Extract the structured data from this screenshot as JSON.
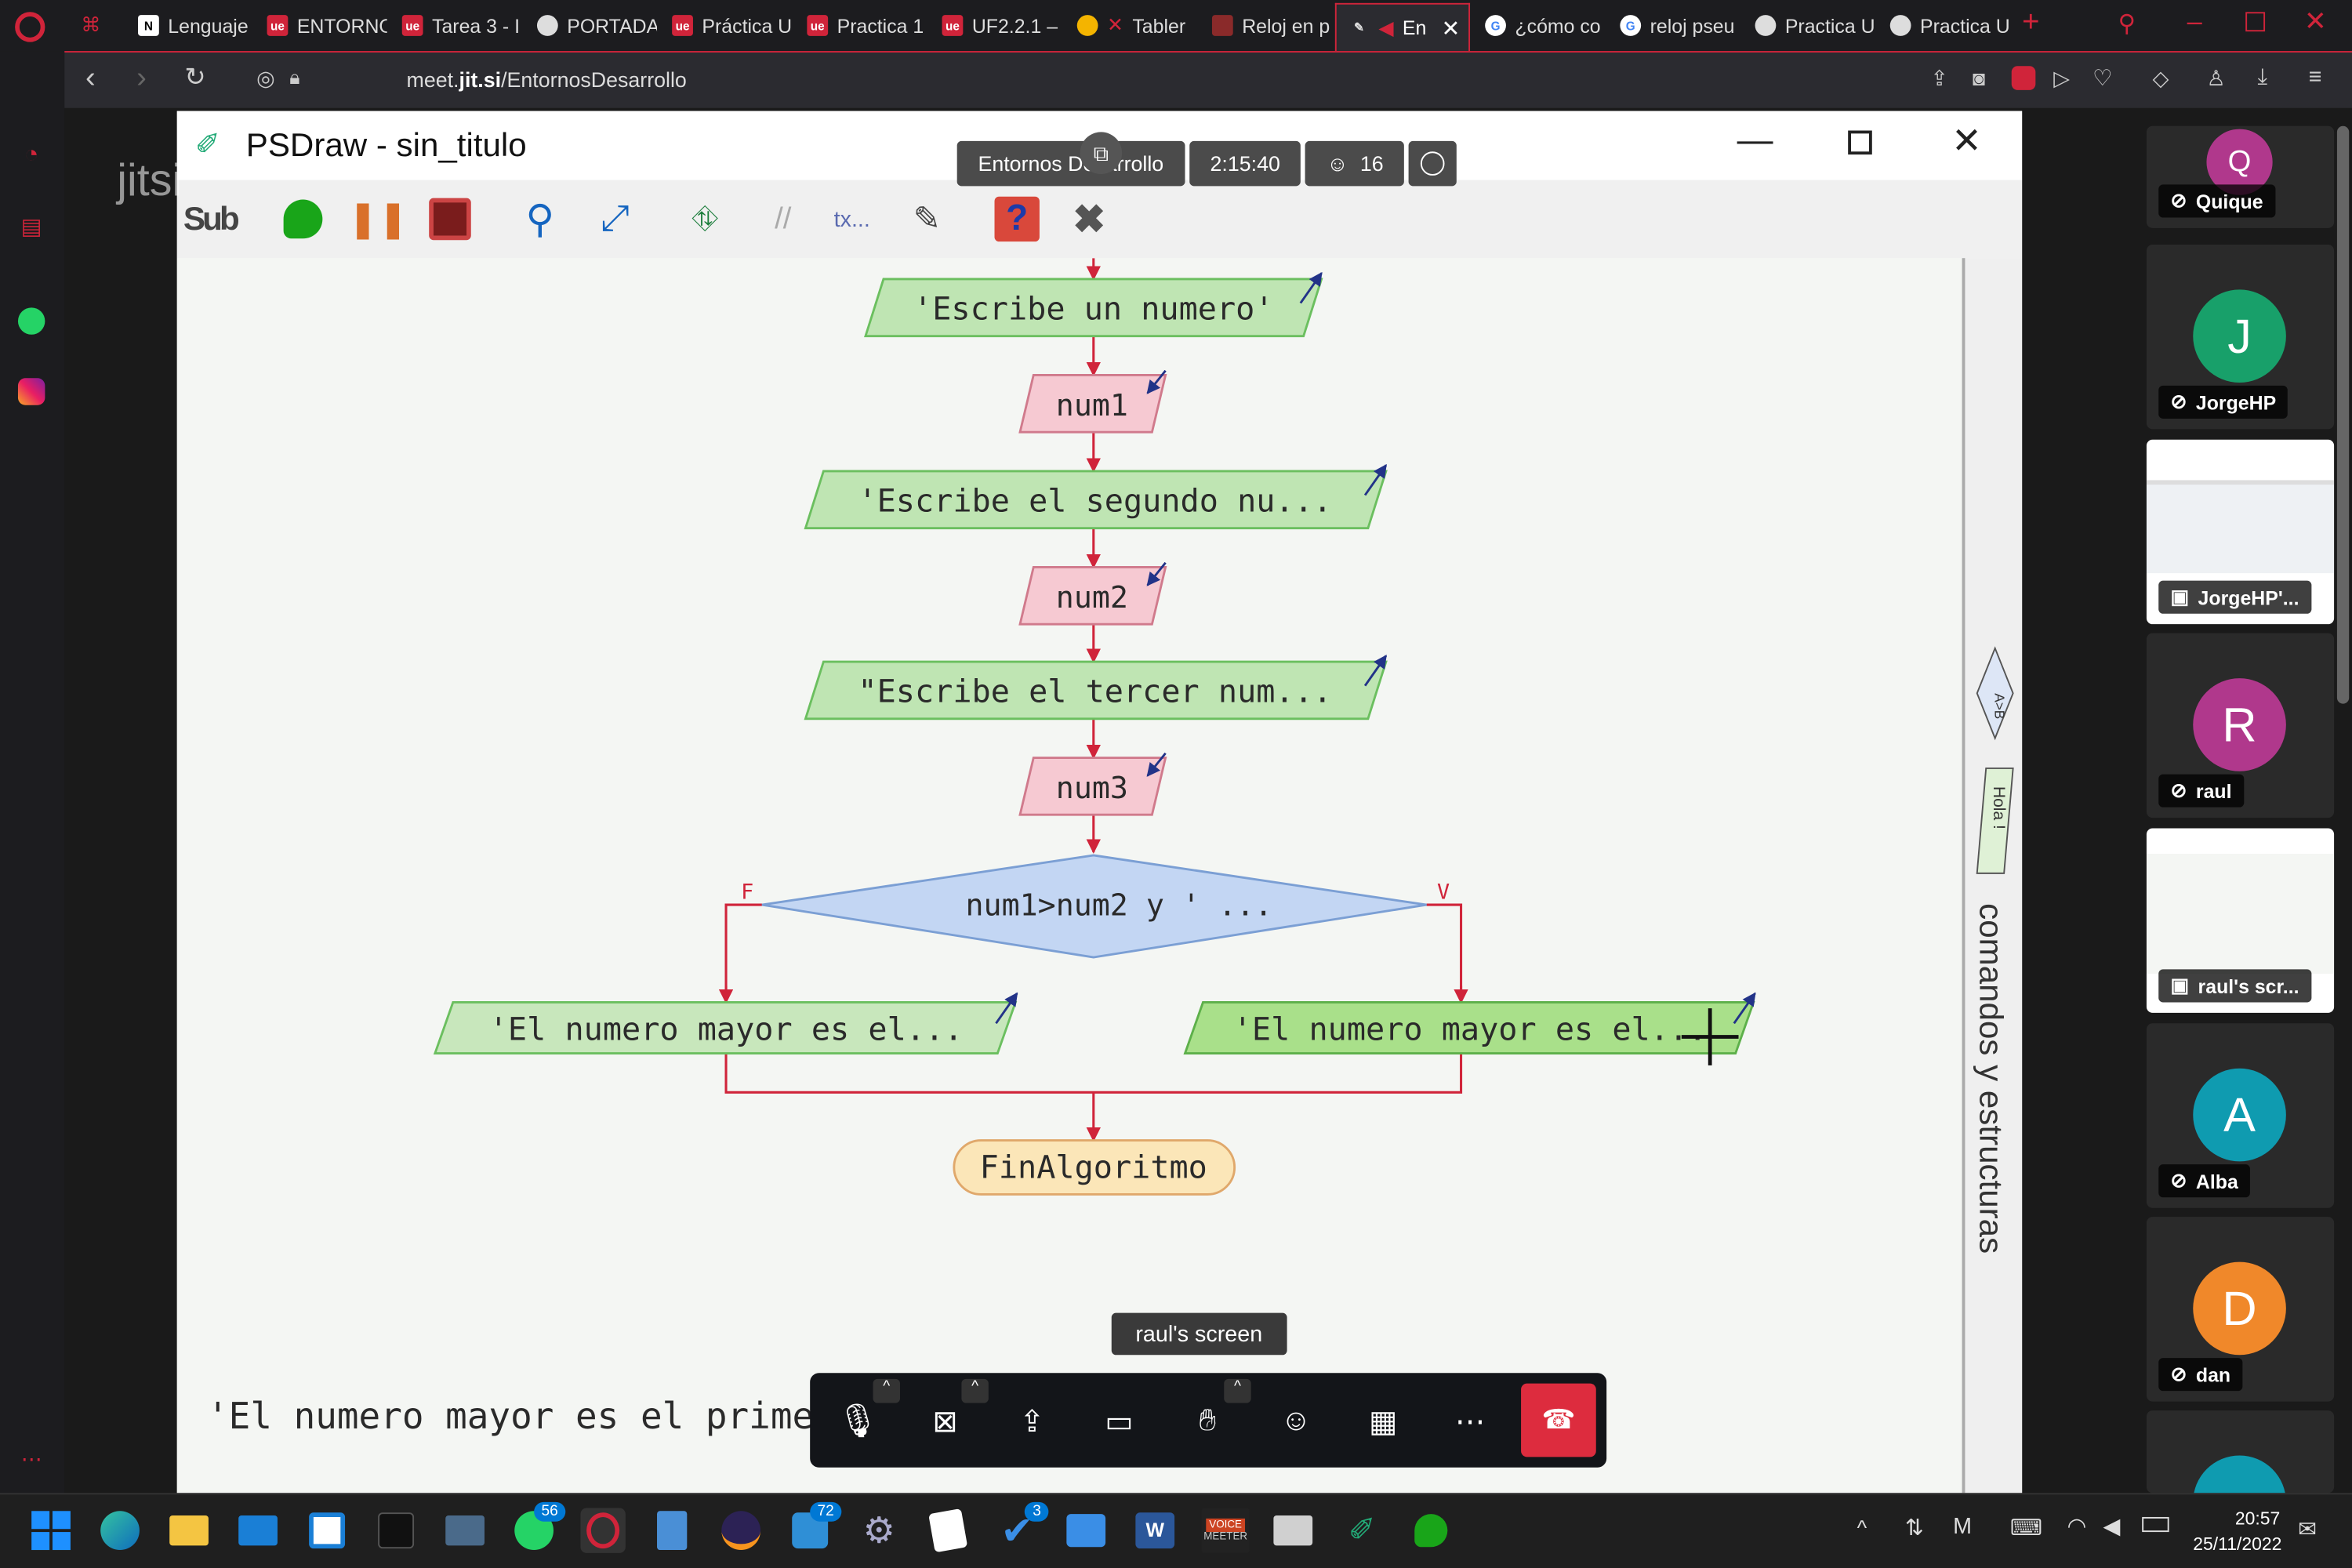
{
  "browser": {
    "tabs": [
      {
        "label": "Lenguaje",
        "favicon": "notion-icon"
      },
      {
        "label": "ENTORNO",
        "favicon": "ue-icon"
      },
      {
        "label": "Tarea 3 - I",
        "favicon": "ue-icon"
      },
      {
        "label": "PORTADA",
        "favicon": "globe-icon"
      },
      {
        "label": "Práctica U",
        "favicon": "ue-icon"
      },
      {
        "label": "Practica 1",
        "favicon": "ue-icon"
      },
      {
        "label": "UF2.2.1 –",
        "favicon": "ue-icon"
      },
      {
        "label": "Tabler",
        "favicon": "emoji-icon"
      },
      {
        "label": "Reloj en p",
        "favicon": "image-icon"
      },
      {
        "label": "En",
        "favicon": "jitsi-icon"
      },
      {
        "label": "¿cómo co",
        "favicon": "google-icon"
      },
      {
        "label": "reloj pseu",
        "favicon": "google-icon"
      },
      {
        "label": "Practica U",
        "favicon": "globe-icon"
      },
      {
        "label": "Practica U",
        "favicon": "globe-icon"
      }
    ],
    "url_host": "meet.",
    "url_bold": "jit.si",
    "url_path": "/EntornosDesarrollo"
  },
  "meeting": {
    "watermark": "jitsi",
    "room_name": "Entornos Desarrollo",
    "duration": "2:15:40",
    "participant_count": "16",
    "screen_label": "raul's screen",
    "participants": [
      {
        "initial": "Q",
        "name": "Quique",
        "color": "#b0388c"
      },
      {
        "initial": "J",
        "name": "JorgeHP",
        "color": "#18a06a"
      },
      {
        "initial": "",
        "name": "JorgeHP'...",
        "color": ""
      },
      {
        "initial": "R",
        "name": "raul",
        "color": "#b0388c"
      },
      {
        "initial": "",
        "name": "raul's scr...",
        "color": ""
      },
      {
        "initial": "A",
        "name": "Alba",
        "color": "#0f9bb0"
      },
      {
        "initial": "D",
        "name": "dan",
        "color": "#f0882a"
      }
    ]
  },
  "psdraw": {
    "window_title": "PSDraw - sin_titulo",
    "toolbar_sub": "Sub",
    "toolbar_tx": "tx...",
    "side_label": "comandos y estructuras",
    "side_shape1": "A>B",
    "side_shape2": "Hola !",
    "nodes": {
      "out1": "'Escribe un numero'",
      "in1": "num1",
      "out2": "'Escribe el segundo nu...",
      "in2": "num2",
      "out3": "\"Escribe el tercer num...",
      "in3": "num3",
      "cond": "num1>num2 y ' ...",
      "false_label": "F",
      "true_label": "V",
      "out_false": "'El numero mayor es el...",
      "out_true": "'El numero mayor es el...",
      "end": "FinAlgoritmo"
    },
    "bottom_text": "'El numero mayor es el primero"
  },
  "taskbar": {
    "whatsapp_badge": "56",
    "mail_badge": "72",
    "todo_badge": "3",
    "voice_label1": "VOICE",
    "voice_label2": "MEETER",
    "time": "20:57",
    "date": "25/11/2022"
  }
}
